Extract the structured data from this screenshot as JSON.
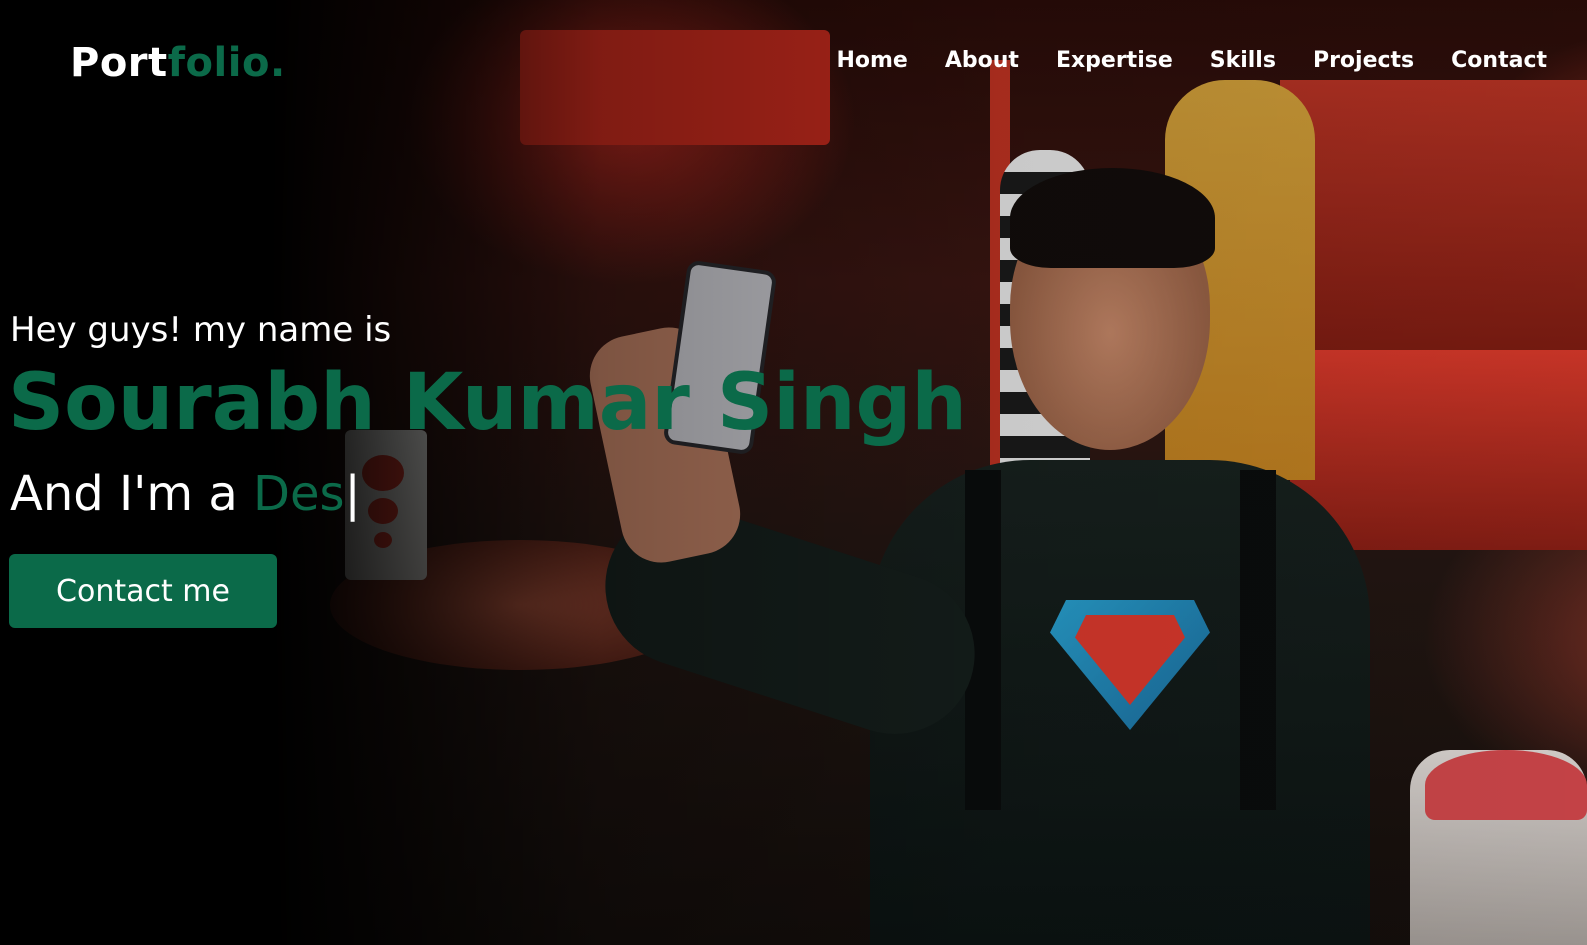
{
  "brand": {
    "prefix": "Port",
    "suffix": "folio."
  },
  "nav": {
    "items": [
      "Home",
      "About",
      "Expertise",
      "Skills",
      "Projects",
      "Contact"
    ]
  },
  "hero": {
    "greeting": "Hey guys! my name is",
    "name": "Sourabh Kumar Singh",
    "role_prefix": "And I'm a ",
    "role_typed": "Des",
    "caret": "|",
    "cta_label": "Contact me"
  },
  "colors": {
    "accent": "#0b6a49",
    "background": "#000000",
    "text": "#ffffff"
  }
}
